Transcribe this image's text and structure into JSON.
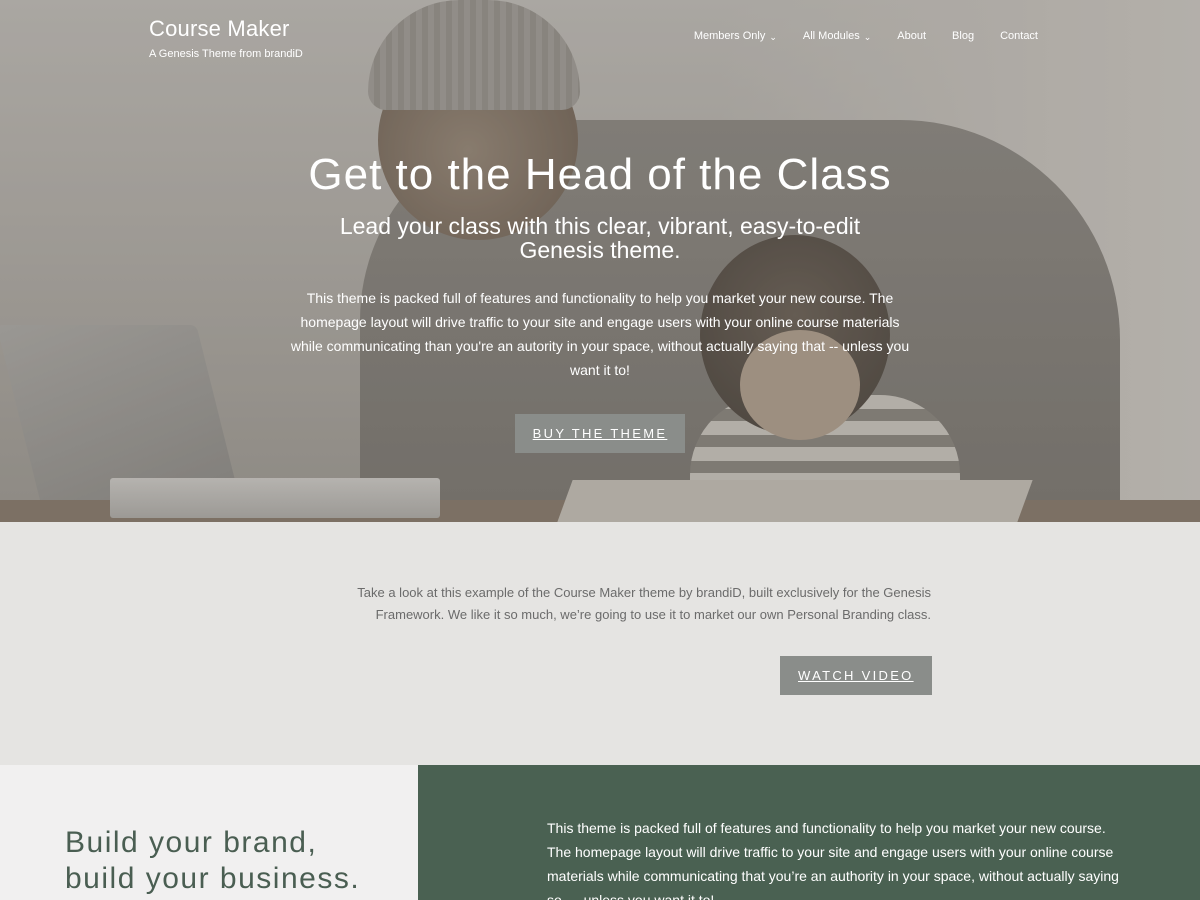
{
  "site": {
    "title": "Course Maker",
    "tagline": "A Genesis Theme from brandiD"
  },
  "nav": {
    "items": [
      {
        "label": "Members Only",
        "has_dropdown": true
      },
      {
        "label": "All Modules",
        "has_dropdown": true
      },
      {
        "label": "About",
        "has_dropdown": false
      },
      {
        "label": "Blog",
        "has_dropdown": false
      },
      {
        "label": "Contact",
        "has_dropdown": false
      }
    ],
    "chevron": "⌄"
  },
  "hero": {
    "heading": "Get to the Head of the Class",
    "subheading": "Lead your class with this clear, vibrant, easy-to-edit Genesis theme.",
    "body": "This theme is packed full of features and functionality to help you market your new course. The homepage layout will drive traffic to your site and engage users with your online course materials while communicating than you're an autority in your space, without actually saying that -- unless you want it to!",
    "button_label": "BUY THE THEME"
  },
  "intro": {
    "text": "Take a look at this example of the Course Maker theme by brandiD, built exclusively for the Genesis Framework. We like it so much, we’re going to use it to market our own Personal Branding class.",
    "button_label": "WATCH VIDEO"
  },
  "feature": {
    "heading_line1": "Build your brand,",
    "heading_line2": "build your business.",
    "text": "This theme is packed full of features and functionality to help you market your new course. The homepage layout will drive traffic to your site and engage users with your online course materials while communicating that you’re an authority in your space, without actually saying so — unless you want it to!"
  },
  "colors": {
    "button_gray": "#8a8d8a",
    "intro_bg": "#e5e4e2",
    "feature_green": "#4a6152",
    "heading_green": "#4a5e52"
  }
}
